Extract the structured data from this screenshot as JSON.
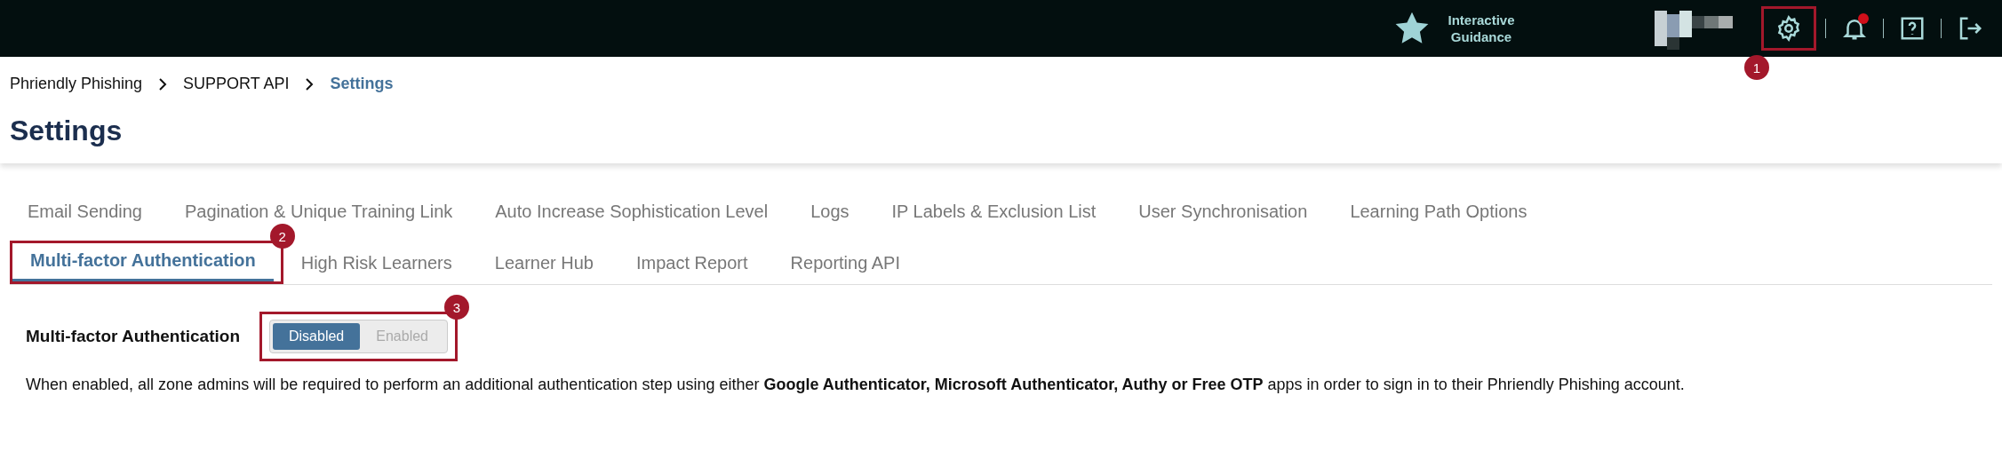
{
  "topbar": {
    "guidance": {
      "label": "Interactive Guidance"
    },
    "icons": [
      {
        "kind": "settings",
        "callout": "1",
        "badge": false
      },
      {
        "kind": "bell",
        "badge": true
      },
      {
        "kind": "help",
        "badge": false
      },
      {
        "kind": "logout",
        "badge": false
      }
    ]
  },
  "breadcrumb": [
    {
      "label": "Phriendly Phishing",
      "current": false
    },
    {
      "label": "SUPPORT API",
      "current": false
    },
    {
      "label": "Settings",
      "current": true
    }
  ],
  "page_title": "Settings",
  "tab_rows": [
    [
      {
        "label": "Email Sending",
        "selected": false
      },
      {
        "label": "Pagination & Unique Training Link",
        "selected": false
      },
      {
        "label": "Auto Increase Sophistication Level",
        "selected": false
      },
      {
        "label": "Logs",
        "selected": false
      },
      {
        "label": "IP Labels & Exclusion List",
        "selected": false
      },
      {
        "label": "User Synchronisation",
        "selected": false
      },
      {
        "label": "Learning Path Options",
        "selected": false
      }
    ],
    [
      {
        "label": "Multi-factor Authentication",
        "selected": true,
        "callout": "2"
      },
      {
        "label": "High Risk Learners",
        "selected": false
      },
      {
        "label": "Learner Hub",
        "selected": false
      },
      {
        "label": "Impact Report",
        "selected": false
      },
      {
        "label": "Reporting API",
        "selected": false
      }
    ]
  ],
  "setting": {
    "label": "Multi-factor Authentication",
    "callout": "3",
    "options": [
      {
        "label": "Disabled",
        "selected": true
      },
      {
        "label": "Enabled",
        "selected": false
      }
    ],
    "description": "When enabled, all zone admins will be required to perform an additional authentication step using either **Google Authenticator, Microsoft Authenticator, Authy or Free OTP** apps in order to sign in to their Phriendly Phishing account."
  }
}
